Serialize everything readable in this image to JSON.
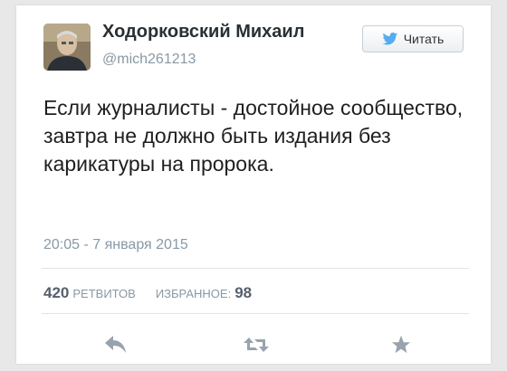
{
  "tweet": {
    "author_name": "Ходорковский Михаил",
    "handle": "@mich261213",
    "follow_label": "Читать",
    "text": "Если журналисты - достойное сообщество, завтра не должно быть издания без карикатуры на пророка.",
    "timestamp": "20:05 - 7 января 2015",
    "retweets_count": "420",
    "retweets_label": "РЕТВИТОВ",
    "favorites_label": "ИЗБРАННОЕ:",
    "favorites_count": "98"
  },
  "icons": {
    "bird": "twitter-bird-icon",
    "reply": "reply-icon",
    "retweet": "retweet-icon",
    "favorite": "star-icon"
  },
  "colors": {
    "brand_blue": "#55acee",
    "muted_text": "#8899a6",
    "action_icon": "#99a3ad"
  }
}
